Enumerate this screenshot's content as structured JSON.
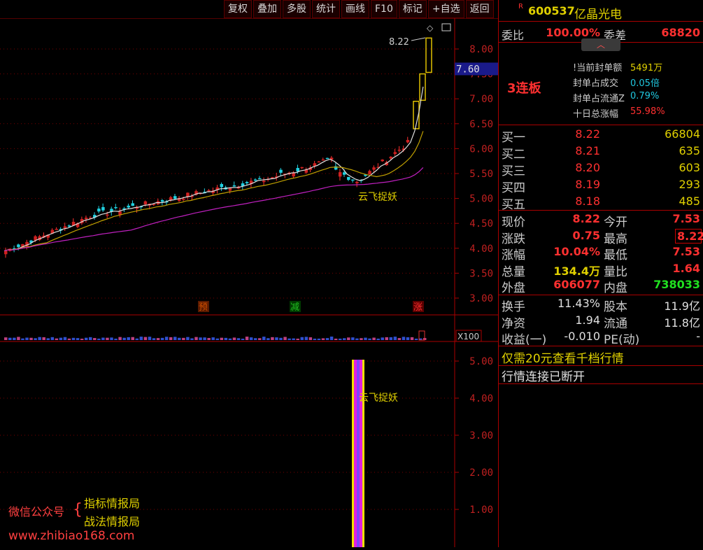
{
  "toolbar": [
    "复权",
    "叠加",
    "多股",
    "统计",
    "画线",
    "F10",
    "标记",
    "+自选",
    "返回"
  ],
  "stock": {
    "badge": "R",
    "code": "600537",
    "name": "亿晶光电"
  },
  "ratio": {
    "wb_label": "委比",
    "wb_value": "100.00%",
    "wc_label": "委差",
    "wc_value": "68820"
  },
  "seal": {
    "streak": "3连板",
    "rows": [
      {
        "label": "!当前封单额",
        "value": "5491万"
      },
      {
        "label": "封单占成交",
        "value": "0.05倍"
      },
      {
        "label": "封单占流通Z",
        "value": "0.79%"
      },
      {
        "label": "十日总涨幅",
        "value": "55.98%"
      }
    ]
  },
  "bids": [
    {
      "label": "买一",
      "price": "8.22",
      "vol": "66804"
    },
    {
      "label": "买二",
      "price": "8.21",
      "vol": "635"
    },
    {
      "label": "买三",
      "price": "8.20",
      "vol": "603"
    },
    {
      "label": "买四",
      "price": "8.19",
      "vol": "293"
    },
    {
      "label": "买五",
      "price": "8.18",
      "vol": "485"
    }
  ],
  "quote": [
    {
      "l1": "现价",
      "v1": "8.22",
      "l2": "今开",
      "v2": "7.53"
    },
    {
      "l1": "涨跌",
      "v1": "0.75",
      "l2": "最高",
      "v2": "8.22"
    },
    {
      "l1": "涨幅",
      "v1": "10.04%",
      "l2": "最低",
      "v2": "7.53"
    },
    {
      "l1": "总量",
      "v1": "134.4万",
      "l2": "量比",
      "v2": "1.64"
    },
    {
      "l1": "外盘",
      "v1": "606077",
      "l2": "内盘",
      "v2": "738033"
    }
  ],
  "fundamentals": [
    {
      "l1": "换手",
      "v1": "11.43%",
      "l2": "股本",
      "v2": "11.9亿"
    },
    {
      "l1": "净资",
      "v1": "1.94",
      "l2": "流通",
      "v2": "11.8亿"
    },
    {
      "l1": "收益(一)",
      "v1": "-0.010",
      "l2": "PE(动)",
      "v2": "-"
    }
  ],
  "promo": "仅需20元查看千档行情",
  "status": "行情连接已断开",
  "price_axis": [
    "8.00",
    "7.50",
    "7.00",
    "6.50",
    "6.00",
    "5.50",
    "5.00",
    "4.50",
    "4.00",
    "3.50",
    "3.00"
  ],
  "lower_axis": [
    "5.00",
    "4.00",
    "3.00",
    "2.00",
    "1.00"
  ],
  "current_price_tag": "7.60",
  "high_annotation": "8.22",
  "signal_label": "云飞捉妖",
  "signal_label_lower": "云飞捉妖",
  "markers": [
    {
      "text": "预"
    },
    {
      "text": "减"
    },
    {
      "text": "涨"
    }
  ],
  "vol_unit": "X100",
  "watermark": {
    "wechat": "微信公众号",
    "line1": "指标情报局",
    "line2": "战法情报局",
    "site": "www.zhibiao168.com"
  }
}
